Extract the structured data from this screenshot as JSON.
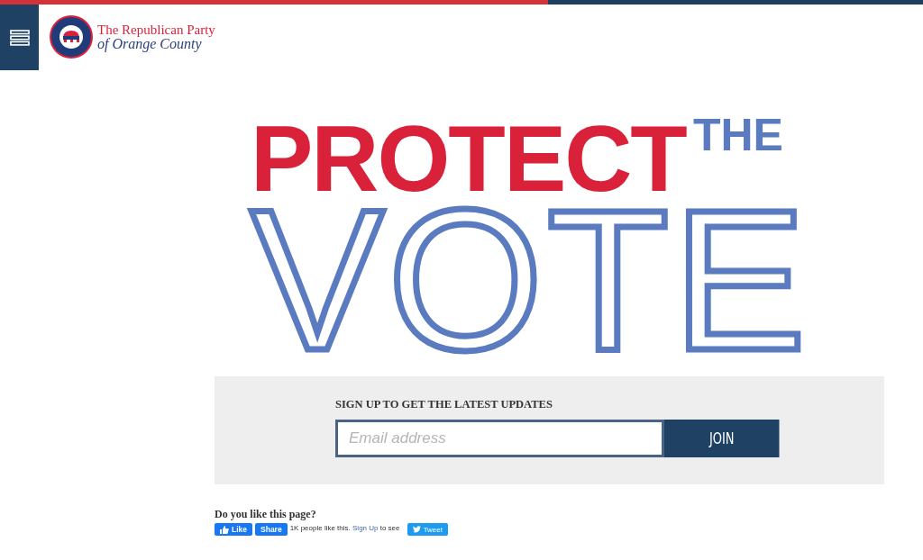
{
  "header": {
    "logo": {
      "line_1": "The Republican Party",
      "line_2": "of Orange County"
    }
  },
  "hero": {
    "line_1": "PROTECT",
    "line_1_suffix": "THE",
    "line_2": "VOTE"
  },
  "signup": {
    "heading": "SIGN UP TO GET THE LATEST UPDATES",
    "placeholder": "Email address",
    "button": "JOIN"
  },
  "social": {
    "question": "Do you like this page?",
    "like_button": "Like",
    "share_button": "Share",
    "like_text_prefix": "1K people like this.",
    "like_link": "Sign Up",
    "like_text_suffix": "to see",
    "tweet_button": "Tweet"
  }
}
